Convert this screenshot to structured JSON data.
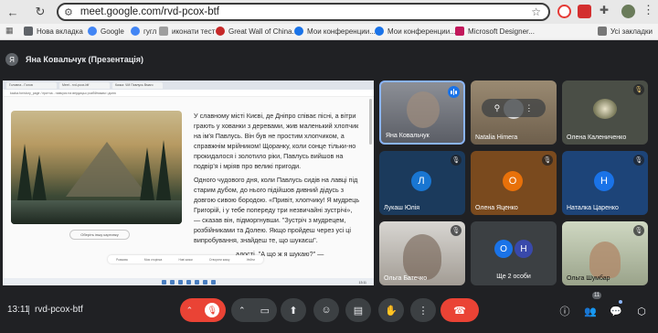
{
  "browser": {
    "url": "meet.google.com/rvd-pcox-btf",
    "bookmarks": [
      {
        "label": "Нова вкладка",
        "color": "#5f6368"
      },
      {
        "label": "Google",
        "color": "#4285f4"
      },
      {
        "label": "гугл",
        "color": "#4285f4"
      },
      {
        "label": "иконати тест",
        "color": "#9e9e9e"
      },
      {
        "label": "Great Wall of China...",
        "color": "#c62828"
      },
      {
        "label": "Мои конференции...",
        "color": "#1a73e8"
      },
      {
        "label": "Мои конференции...",
        "color": "#1a73e8"
      },
      {
        "label": "Microsoft Designer...",
        "color": "#c2185b"
      }
    ],
    "all_bookmarks": "Усі закладки"
  },
  "presenter": {
    "initial": "Я",
    "title": "Яна Ковальчук (Презентація)"
  },
  "presentation": {
    "tabs": [
      "Головна - Голов",
      "Meet - rvd-pcox-btf",
      "Казка: ЧМ Павлусь Вмаго"
    ],
    "url": "kazka.for/story_page / притча - навчуся на вердицьо розбійникам і долю",
    "image_caption_button": "Оберіть іншу картинку",
    "paragraphs": [
      "У славному місті Києві, де Дніпро співає пісні, а вітри грають у хованки з деревами, жив маленький хлопчик на ім'я Павлусь. Він був не простим хлопчиком, а справжнім мрійником! Щоранку, коли сонце тільки-но прокидалося і золотило ріки, Павлусь вийшов на подвір'я і мріяв про великі пригоди.",
      "Одного чудового дня, коли Павлусь сидів на лавці під старим дубом, до нього підійшов дивний дідусь з довгою сивою бородою. «Привіт, хлопчику! Я мудрець Григорій, і у тебе попереду три незвичайні зустрічі», — сказав він, підморгнувши. \"Зустріч з мудрецем, розбійниками та Долею. Якщо пройдеш через усі ці випробування, знайдеш те, що шукаєш\".",
      "...адості. \"А що ж я шукаю?\" —"
    ],
    "bottom_toolbar": [
      "Розмова",
      "Моя сторінка",
      "Нові казки",
      "Створити казку",
      "Увійти"
    ],
    "taskbar_time": "13:11"
  },
  "participants": [
    {
      "name": "Яна Ковальчук",
      "type": "video",
      "speaking": true
    },
    {
      "name": "Natalia Himera",
      "type": "video",
      "muted": false
    },
    {
      "name": "Олена Калениченко",
      "type": "video",
      "muted": true
    },
    {
      "name": "Лукаш Юлія",
      "type": "avatar",
      "initial": "Л",
      "color": "#1976d2",
      "muted": true
    },
    {
      "name": "Олена Яценко",
      "type": "avatar",
      "initial": "О",
      "color": "#e8710a",
      "muted": true
    },
    {
      "name": "Наталка Царенко",
      "type": "avatar",
      "initial": "Н",
      "color": "#1a73e8",
      "muted": true
    },
    {
      "name": "Ольга Батечко",
      "type": "video",
      "muted": true
    },
    {
      "name": "Ще 2 особи",
      "type": "group",
      "initials": [
        "О",
        "Н"
      ],
      "colors": [
        "#1a73e8",
        "#3949ab"
      ]
    },
    {
      "name": "Ольга Шумбар",
      "type": "video",
      "muted": true
    }
  ],
  "controls": {
    "time": "13:11",
    "meeting_code": "rvd-pcox-btf",
    "participant_count": "11"
  }
}
